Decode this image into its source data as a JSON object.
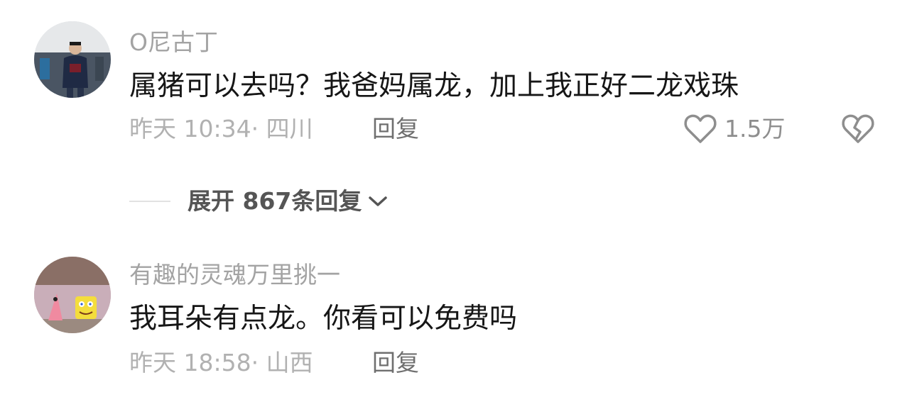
{
  "comments": [
    {
      "username": "O尼古丁",
      "text": "属猪可以去吗？我爸妈属龙，加上我正好二龙戏珠",
      "time_location": "昨天 10:34· 四川",
      "reply_label": "回复",
      "likes": "1.5万",
      "avatar_icon": "user-avatar-photo"
    },
    {
      "username": "有趣的灵魂万里挑一",
      "text": "我耳朵有点龙。你看可以免费吗",
      "time_location": "昨天 18:58· 山西",
      "reply_label": "回复",
      "avatar_icon": "cartoon-avatar"
    }
  ],
  "expand_replies": {
    "label": "展开 867条回复"
  },
  "colors": {
    "text_primary": "#161616",
    "text_secondary": "#a3a3a3",
    "reply": "#6f6f6f",
    "icon": "#8e8e8e"
  }
}
